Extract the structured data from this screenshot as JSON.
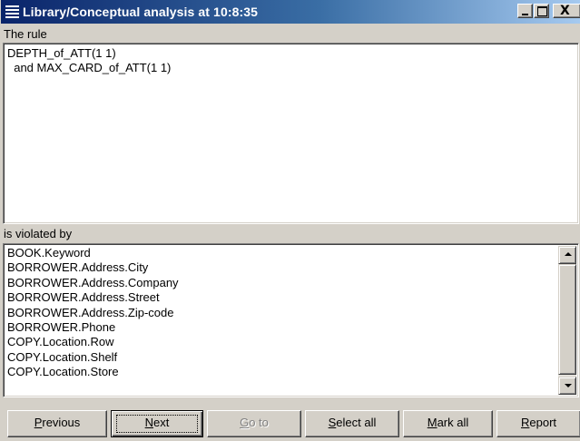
{
  "window": {
    "title": "Library/Conceptual analysis at 10:8:35",
    "controls": {
      "minimize_icon": "minimize-icon",
      "maximize_icon": "maximize-icon",
      "close_icon": "close-icon",
      "close_glyph": "X"
    }
  },
  "rule": {
    "label": "The rule",
    "text": "DEPTH_of_ATT(1 1)\n  and MAX_CARD_of_ATT(1 1)"
  },
  "violations": {
    "label": "is violated by",
    "items": [
      "BOOK.Keyword",
      "BORROWER.Address.City",
      "BORROWER.Address.Company",
      "BORROWER.Address.Street",
      "BORROWER.Address.Zip-code",
      "BORROWER.Phone",
      "COPY.Location.Row",
      "COPY.Location.Shelf",
      "COPY.Location.Store"
    ]
  },
  "buttons": {
    "previous": {
      "pre": "",
      "key": "P",
      "post": "revious"
    },
    "next": {
      "pre": "",
      "key": "N",
      "post": "ext"
    },
    "goto": {
      "pre": "",
      "key": "G",
      "post": "o to"
    },
    "selectall": {
      "pre": "",
      "key": "S",
      "post": "elect all"
    },
    "markall": {
      "pre": "",
      "key": "M",
      "post": "ark all"
    },
    "report": {
      "pre": "",
      "key": "R",
      "post": "eport"
    }
  },
  "colors": {
    "titlebar_start": "#0a246a",
    "titlebar_end": "#a6caf0",
    "face": "#d4d0c8"
  }
}
